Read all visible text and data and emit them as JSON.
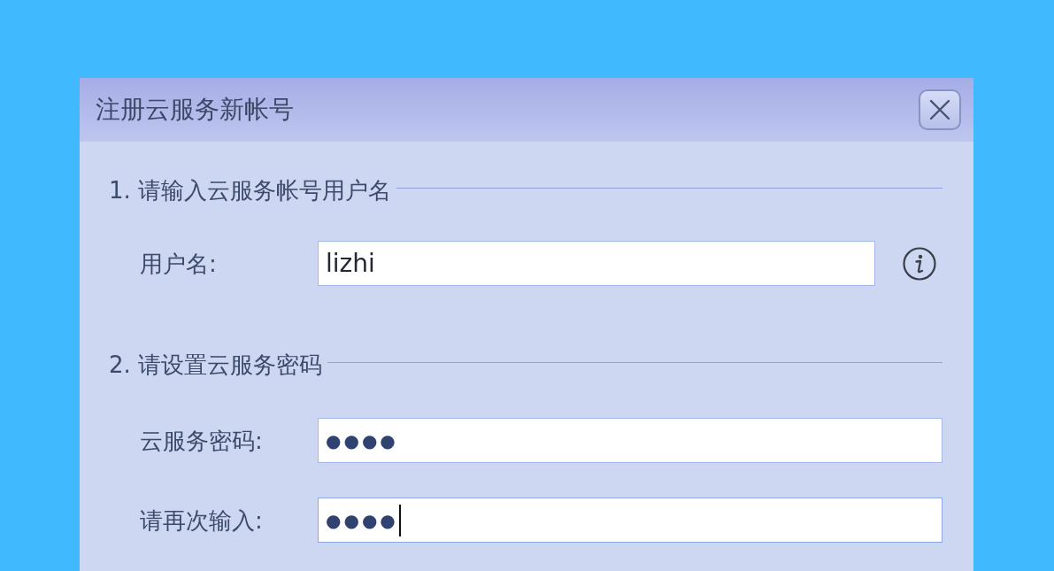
{
  "dialog": {
    "title": "注册云服务新帐号"
  },
  "sections": [
    {
      "heading": "1. 请输入云服务帐号用户名",
      "fields": [
        {
          "label": "用户名:",
          "kind": "text",
          "value": "lizhi",
          "focused": false,
          "info": true
        }
      ]
    },
    {
      "heading": "2. 请设置云服务密码",
      "fields": [
        {
          "label": "云服务密码:",
          "kind": "password",
          "value": "●●●●",
          "focused": false,
          "info": false
        },
        {
          "label": "请再次输入:",
          "kind": "password",
          "value": "●●●●",
          "focused": true,
          "info": false
        }
      ]
    }
  ]
}
